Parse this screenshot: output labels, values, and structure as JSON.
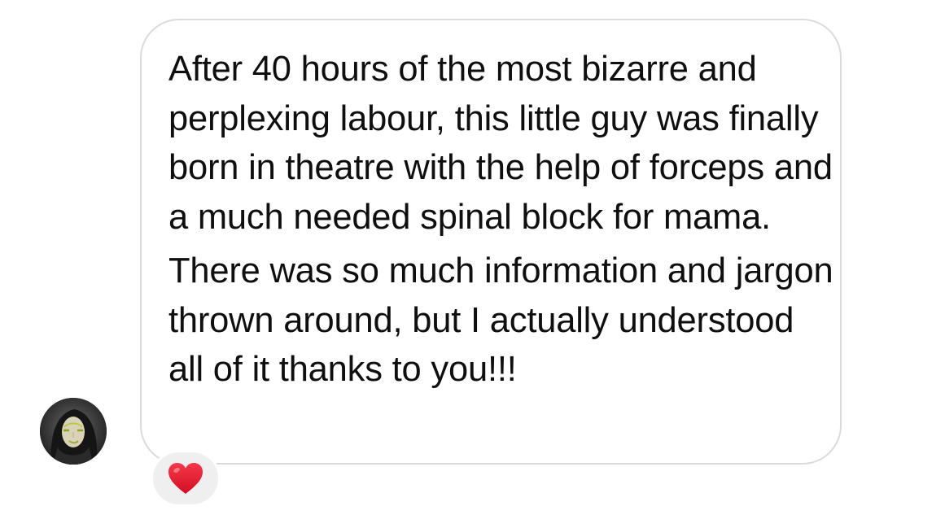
{
  "message": {
    "paragraphs": [
      "After 40 hours of the most bizarre and perplexing labour, this little guy was finally born in theatre with the help of forceps and a much needed spinal block for mama.",
      "There was so much information and jargon thrown around, but I actually understood all of it thanks to you!!!"
    ]
  },
  "reaction": {
    "icon": "red-heart-icon",
    "color": "#e0152a"
  },
  "sender": {
    "avatar_icon": "user-avatar-photo"
  },
  "colors": {
    "bubble_border": "#dbdbdb",
    "text": "#0f0f0f",
    "reaction_background": "#efefef"
  }
}
